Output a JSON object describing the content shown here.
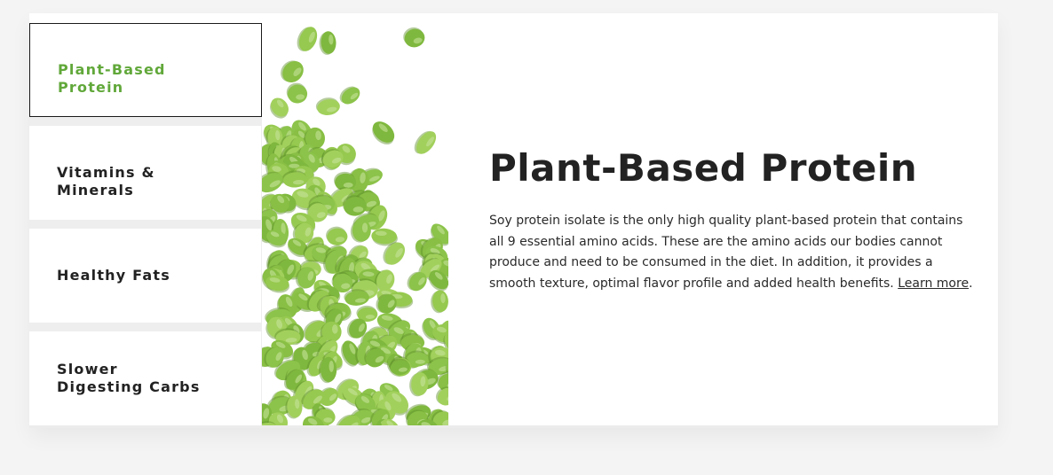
{
  "tabs": [
    {
      "label": "Plant-Based Protein",
      "active": true
    },
    {
      "label": "Vitamins & Minerals",
      "active": false
    },
    {
      "label": "Healthy Fats",
      "active": false
    },
    {
      "label": "Slower Digesting Carbs",
      "active": false
    }
  ],
  "image": {
    "subject": "edamame-beans",
    "bean_color": "#8cc34a"
  },
  "content": {
    "title": "Plant-Based Protein",
    "description": "Soy protein isolate is the only high quality plant-based protein that contains all 9 essential amino acids. These are the amino acids our bodies cannot produce and need to be consumed in the diet. In addition, it provides a smooth texture, optimal flavor profile and added health benefits.",
    "link_text": "Learn more",
    "trailing_text": "."
  },
  "colors": {
    "accent": "#61a83a",
    "text": "#222222",
    "page_background": "#f4f4f4"
  }
}
